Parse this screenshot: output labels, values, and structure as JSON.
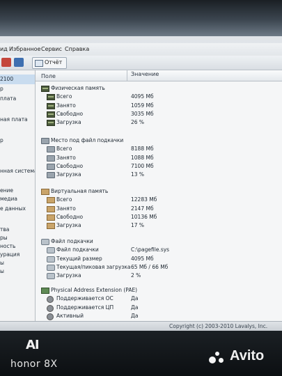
{
  "menu": {
    "items": [
      "Избранное",
      "Сервис",
      "Справка"
    ],
    "partial_left": "ид"
  },
  "toolbar": {
    "report_label": "Отчёт"
  },
  "left_panel": {
    "items": [
      "2100",
      "р",
      "плата",
      "",
      "ная плата",
      "",
      "р",
      "",
      "",
      "нная система",
      "",
      "ение",
      "медиа",
      "е данных",
      "",
      "тва",
      "ры",
      "ность",
      "урация",
      "ы",
      "ы"
    ]
  },
  "table": {
    "col_field": "Поле",
    "col_value": "Значение",
    "groups": [
      {
        "label": "Физическая память",
        "icon": "memory-icon",
        "rows": [
          {
            "field": "Всего",
            "value": "4095 Мб"
          },
          {
            "field": "Занято",
            "value": "1059 Мб"
          },
          {
            "field": "Свободно",
            "value": "3035 Мб"
          },
          {
            "field": "Загрузка",
            "value": "26 %"
          }
        ]
      },
      {
        "label": "Место под файл подкачки",
        "icon": "pagefile-icon",
        "rows": [
          {
            "field": "Всего",
            "value": "8188 Мб"
          },
          {
            "field": "Занято",
            "value": "1088 Мб"
          },
          {
            "field": "Свободно",
            "value": "7100 Мб"
          },
          {
            "field": "Загрузка",
            "value": "13 %"
          }
        ]
      },
      {
        "label": "Виртуальная память",
        "icon": "virtual-memory-icon",
        "rows": [
          {
            "field": "Всего",
            "value": "12283 Мб"
          },
          {
            "field": "Занято",
            "value": "2147 Мб"
          },
          {
            "field": "Свободно",
            "value": "10136 Мб"
          },
          {
            "field": "Загрузка",
            "value": "17 %"
          }
        ]
      },
      {
        "label": "Файл подкачки",
        "icon": "disk-icon",
        "rows": [
          {
            "field": "Файл подкачки",
            "value": "C:\\pagefile.sys"
          },
          {
            "field": "Текущий размер",
            "value": "4095 Мб"
          },
          {
            "field": "Текущая/пиковая загрузка",
            "value": "65 Мб / 66 Мб"
          },
          {
            "field": "Загрузка",
            "value": "2 %"
          }
        ]
      },
      {
        "label": "Physical Address Extension (PAE)",
        "icon": "pae-icon",
        "rows": [
          {
            "field": "Поддерживается ОС",
            "value": "Да"
          },
          {
            "field": "Поддерживается ЦП",
            "value": "Да"
          },
          {
            "field": "Активный",
            "value": "Да"
          }
        ]
      }
    ]
  },
  "footer": {
    "copyright": "Copyright (c) 2003-2010 Lavalys, Inc."
  },
  "phone": {
    "camera_badge": "AI",
    "brand": "honor 8X"
  },
  "watermark": {
    "text": "Avito"
  }
}
